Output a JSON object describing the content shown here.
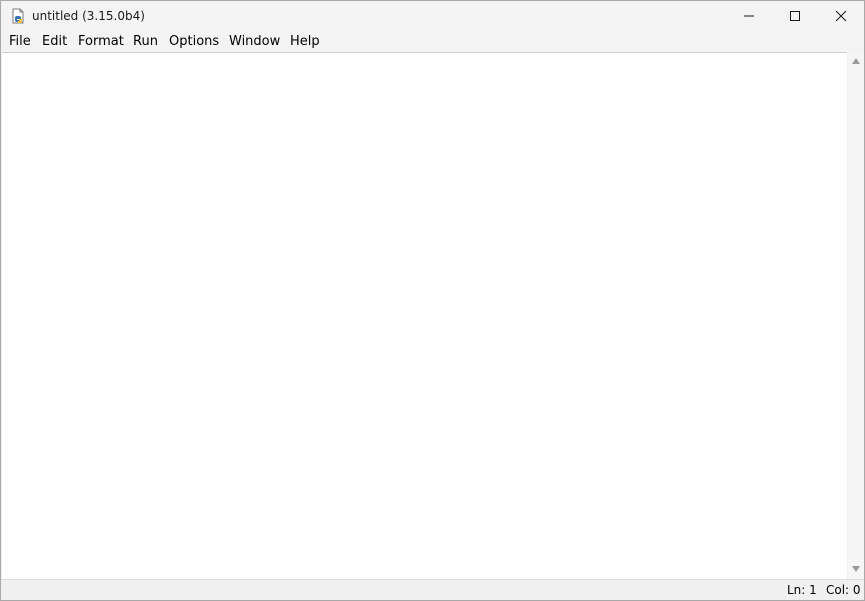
{
  "window": {
    "title": "untitled (3.15.0b4)",
    "app_icon": "python-idle-icon",
    "controls": [
      "minimize-icon",
      "maximize-icon",
      "close-icon"
    ]
  },
  "menubar": {
    "items": [
      {
        "label": "File"
      },
      {
        "label": "Edit"
      },
      {
        "label": "Format"
      },
      {
        "label": "Run"
      },
      {
        "label": "Options"
      },
      {
        "label": "Window"
      },
      {
        "label": "Help"
      }
    ]
  },
  "editor": {
    "content": ""
  },
  "statusbar": {
    "line": "Ln: 1",
    "column": "Col: 0"
  },
  "colors": {
    "titlebar": "#f3f3f3",
    "editor_background": "#ffffff",
    "statusbar": "#f0f0f0"
  }
}
